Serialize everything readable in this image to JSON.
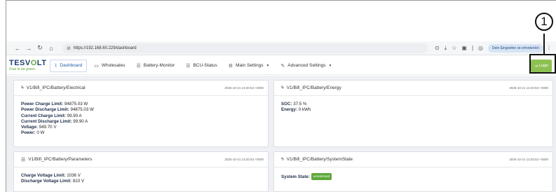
{
  "browser": {
    "url": "https://192.168.60.229/dashboard",
    "profile_label": "Dein Eingreifen ist erforderlich"
  },
  "app": {
    "logo_brand_pre": "TESV",
    "logo_brand_v": "O",
    "logo_brand_post": "LT",
    "logo_tagline": "Free to be green.",
    "nav": [
      {
        "label": "Dashboard"
      },
      {
        "label": "Wholesales"
      },
      {
        "label": "Battery-Monitor"
      },
      {
        "label": "BCU-Status"
      },
      {
        "label": "Main Settings"
      },
      {
        "label": "Advanced Settings"
      }
    ],
    "login_label": "Login",
    "callout_number": "1"
  },
  "cards": {
    "electrical": {
      "title": "V1/Bifi_IPC/Battery/Electrical",
      "timestamp": "2025-10-21 13:20:53 +0000",
      "rows": [
        {
          "key": "Power Charge Limit:",
          "value": " 94875.03 W"
        },
        {
          "key": "Power Discharge Limit:",
          "value": " 94875.03 W"
        },
        {
          "key": "Current Charge Limit:",
          "value": " 99.90 A"
        },
        {
          "key": "Current Discharge Limit:",
          "value": " 99.90 A"
        },
        {
          "key": "Voltage:",
          "value": " 949.70 V"
        },
        {
          "key": "Power:",
          "value": " 0 W"
        }
      ]
    },
    "energy": {
      "title": "V1/Bifi_IPC/Battery/Energy",
      "timestamp": "2025-10-21 13:20:53 +0000",
      "rows": [
        {
          "key": "SOC:",
          "value": " 37.5 %"
        },
        {
          "key": "Energy:",
          "value": " 0 kWh"
        }
      ]
    },
    "parameters": {
      "title": "V1/Bifi_IPC/Battery/Parameters",
      "timestamp": "2025-10-21 13:20:53 +0000",
      "rows": [
        {
          "key": "Charge Voltage Limit:",
          "value": " 1036 V"
        },
        {
          "key": "Discharge Voltage Limit:",
          "value": " 810 V"
        }
      ]
    },
    "systemstate": {
      "title": "V1/Bifi_IPC/Battery/SystemState",
      "timestamp": "2025-10-21 13:20:53 +0000",
      "state_key": "System State:",
      "state_value": "unrestricted"
    }
  },
  "colors": {
    "accent_green": "#8cc152",
    "brand_blue": "#1f3f6e",
    "active_nav": "#1f5fa8"
  },
  "icons": {
    "back": "arrow-left-icon",
    "forward": "arrow-right-icon",
    "reload": "reload-icon",
    "home": "home-icon",
    "dashboard": "chart-icon",
    "wholesales": "monitor-icon",
    "battery_monitor": "table-icon",
    "bcu_status": "table-icon",
    "main_settings": "gear-icon",
    "advanced_settings": "wrench-icon"
  }
}
